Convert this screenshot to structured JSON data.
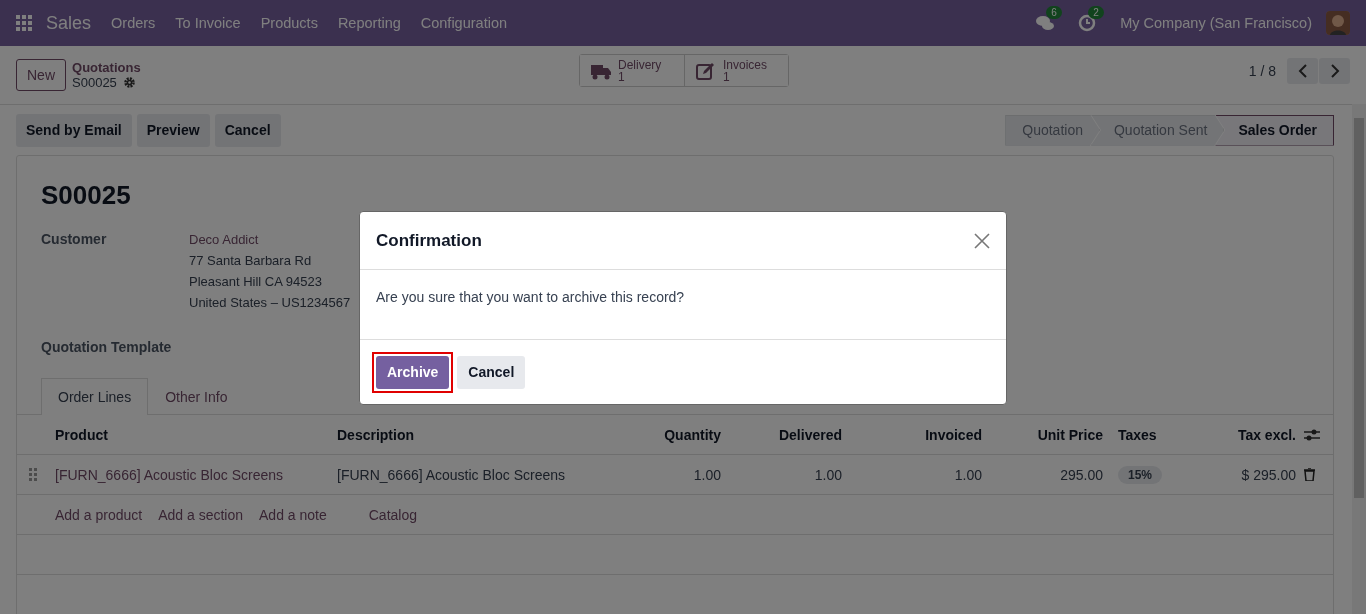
{
  "navbar": {
    "app": "Sales",
    "menu": [
      "Orders",
      "To Invoice",
      "Products",
      "Reporting",
      "Configuration"
    ],
    "messages_count": "6",
    "activities_count": "2",
    "company": "My Company (San Francisco)"
  },
  "control_panel": {
    "new_button": "New",
    "breadcrumb": "Quotations",
    "record": "S00025",
    "smart_buttons": [
      {
        "kind": "delivery",
        "label": "Delivery",
        "value": "1"
      },
      {
        "kind": "invoices",
        "label": "Invoices",
        "value": "1"
      }
    ],
    "pager": "1 / 8"
  },
  "actions": [
    "Send by Email",
    "Preview",
    "Cancel"
  ],
  "statusbar": [
    {
      "label": "Quotation",
      "selected": false
    },
    {
      "label": "Quotation Sent",
      "selected": false
    },
    {
      "label": "Sales Order",
      "selected": true
    }
  ],
  "form": {
    "title": "S00025",
    "customer_label": "Customer",
    "customer_name": "Deco Addict",
    "address": [
      "77 Santa Barbara Rd",
      "Pleasant Hill CA 94523",
      "United States – US1234567"
    ],
    "template_label": "Quotation Template"
  },
  "tabs": [
    {
      "label": "Order Lines",
      "selected": true
    },
    {
      "label": "Other Info",
      "selected": false
    }
  ],
  "table": {
    "columns": [
      "Product",
      "Description",
      "Quantity",
      "Delivered",
      "Invoiced",
      "Unit Price",
      "Taxes",
      "Tax excl."
    ],
    "rows": [
      {
        "product": "[FURN_6666] Acoustic Bloc Screens",
        "description": "[FURN_6666] Acoustic Bloc Screens",
        "quantity": "1.00",
        "delivered": "1.00",
        "invoiced": "1.00",
        "unit_price": "295.00",
        "taxes": "15%",
        "tax_excl": "$ 295.00"
      }
    ],
    "add_links": [
      "Add a product",
      "Add a section",
      "Add a note",
      "Catalog"
    ]
  },
  "dialog": {
    "title": "Confirmation",
    "message": "Are you sure that you want to archive this record?",
    "buttons": [
      {
        "label": "Archive",
        "kind": "primary",
        "highlighted": true
      },
      {
        "label": "Cancel",
        "kind": "secondary",
        "highlighted": false
      }
    ]
  }
}
